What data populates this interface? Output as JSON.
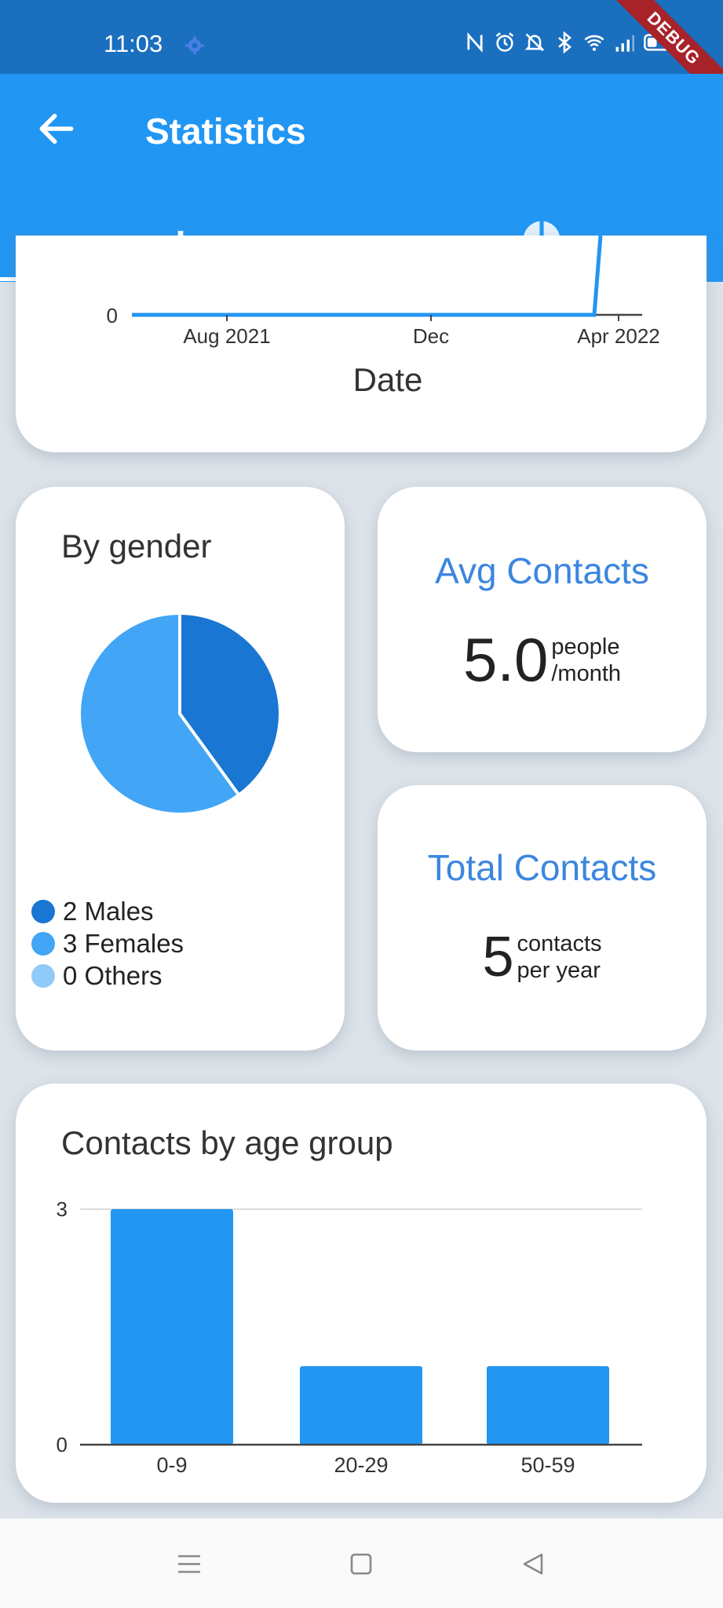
{
  "status_bar": {
    "time": "11:03",
    "debug_label": "DEBUG",
    "icons": [
      "gear-icon",
      "nfc-icon",
      "alarm-icon",
      "mute-icon",
      "bluetooth-icon",
      "wifi-icon",
      "signal-icon",
      "battery-icon"
    ]
  },
  "app_bar": {
    "title": "Statistics",
    "back_icon": "arrow-back-icon",
    "tabs": [
      {
        "icon": "bar-chart-icon",
        "selected": true
      },
      {
        "icon": "pie-chart-icon",
        "selected": false
      }
    ]
  },
  "date_chart": {
    "y_tick": "0",
    "x_ticks": [
      "Aug 2021",
      "Dec",
      "Apr 2022"
    ],
    "xlabel": "Date"
  },
  "gender_card": {
    "title": "By gender",
    "legend": [
      {
        "label": "2 Males",
        "color": "#1976d2"
      },
      {
        "label": "3 Females",
        "color": "#42a5f5"
      },
      {
        "label": "0 Others",
        "color": "#90caf9"
      }
    ]
  },
  "avg_card": {
    "title": "Avg Contacts",
    "value": "5.0",
    "unit_line1": "people",
    "unit_line2": "/month"
  },
  "total_card": {
    "title": "Total Contacts",
    "value": "5",
    "unit_line1": "contacts",
    "unit_line2": "per year"
  },
  "age_card": {
    "title": "Contacts by age group"
  },
  "chart_data": [
    {
      "type": "line",
      "x": [
        "Aug 2021",
        "Dec",
        "Apr 2022"
      ],
      "y_tick_labels": [
        "0"
      ],
      "xlabel": "Date",
      "ylabel": "",
      "grid": false,
      "color": "#2196f3"
    },
    {
      "type": "pie",
      "title": "By gender",
      "categories": [
        "Males",
        "Females",
        "Others"
      ],
      "values": [
        2,
        3,
        0
      ],
      "colors": [
        "#1976d2",
        "#42a5f5",
        "#90caf9"
      ],
      "legend": "bottom-left"
    },
    {
      "type": "bar",
      "title": "Contacts by age group",
      "categories": [
        "0-9",
        "20-29",
        "50-59"
      ],
      "values": [
        3,
        1,
        1
      ],
      "ylim": [
        0,
        3
      ],
      "y_ticks": [
        "0",
        "3"
      ],
      "color": "#2196f3",
      "grid": true
    }
  ],
  "nav_bar": {
    "icons": [
      "menu-icon",
      "home-icon",
      "back-triangle-icon"
    ]
  }
}
